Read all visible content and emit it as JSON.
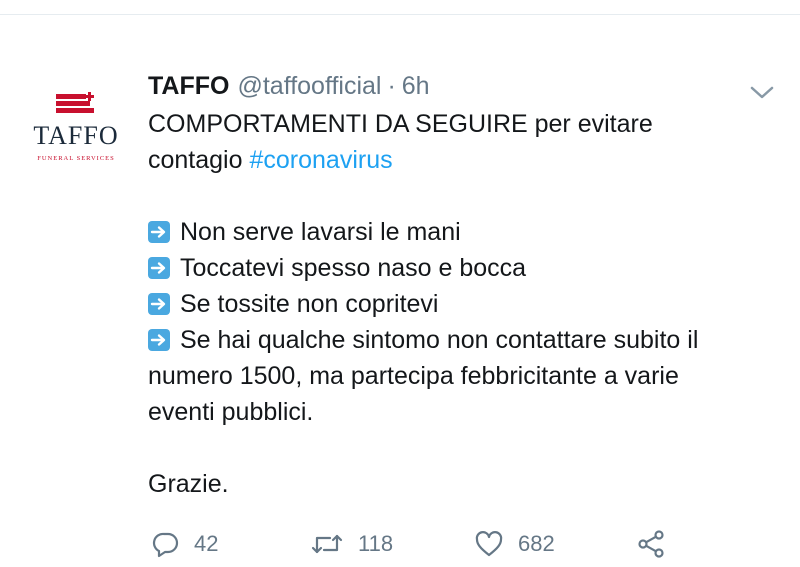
{
  "avatar": {
    "name_text": "TAFFO",
    "subtitle": "FUNERAL SERVICES",
    "logo_color": "#c8102e"
  },
  "tweet": {
    "display_name": "TAFFO",
    "handle": "@taffoofficial",
    "separator": "·",
    "time": "6h",
    "menu_icon": "chevron-down-icon",
    "lines": {
      "l1": "COMPORTAMENTI DA SEGUIRE per evitare",
      "l2_prefix": "contagio ",
      "l2_hashtag": "#coronavirus",
      "bullet1": "Non serve lavarsi le mani",
      "bullet2": "Toccatevi spesso naso e bocca",
      "bullet3": "Se tossite non copritevi",
      "bullet4": "Se hai qualche sintomo non contattare subito il",
      "cont1": "numero 1500, ma partecipa febbricitante a varie",
      "cont2": "eventi pubblici.",
      "closing": "Grazie."
    },
    "bullet_icon": "right-arrow-emoji-icon",
    "hashtag_color": "#1da1f2"
  },
  "actions": {
    "reply_count": "42",
    "retweet_count": "118",
    "like_count": "682",
    "share_icon": "share-icon"
  }
}
